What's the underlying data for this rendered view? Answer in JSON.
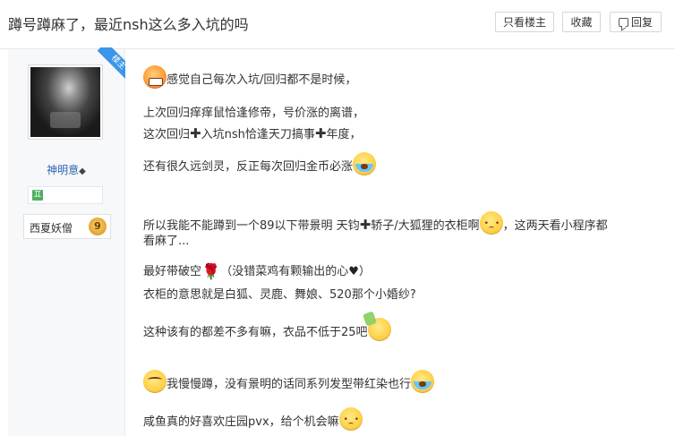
{
  "header": {
    "title": "蹲号蹲麻了，最近nsh这么多入坑的吗",
    "only_op_label": "只看楼主",
    "favorite_label": "收藏",
    "reply_label": "回复"
  },
  "author": {
    "badge": "楼主",
    "name": "神明意",
    "name_suffix": "◆",
    "tag_icon": "♊",
    "server": "西夏妖僧",
    "level": "9"
  },
  "post": {
    "lines": [
      "感觉自己每次入坑/回归都不是时候，",
      "上次回归痒痒鼠恰逢修帝，号价涨的离谱，",
      "这次回归",
      "入坑nsh恰逢天刀搞事",
      "年度，",
      "还有很久远剑灵，反正每次回归金币必涨",
      "所以我能不能蹲到一个89以下带景明 天钧",
      "轿子/大狐狸的衣柜啊",
      "，这两天看小程序都",
      "看麻了...",
      "最好带破空",
      "（没错菜鸡有颗输出的心",
      "）",
      "衣柜的意思就是白狐、灵鹿、舞娘、520那个小婚纱?",
      "这种该有的都差不多有嘛，衣品不低于25吧",
      "我慢慢蹲，没有景明的话同系列发型带红染也行",
      "咸鱼真的好喜欢庄园pvx，给个机会嘛"
    ],
    "cross_glyph": "✚",
    "rose_glyph": "🌹",
    "heart_glyph": "♥"
  },
  "colors": {
    "link": "#2d64b3",
    "badge": "#3b95e8"
  }
}
